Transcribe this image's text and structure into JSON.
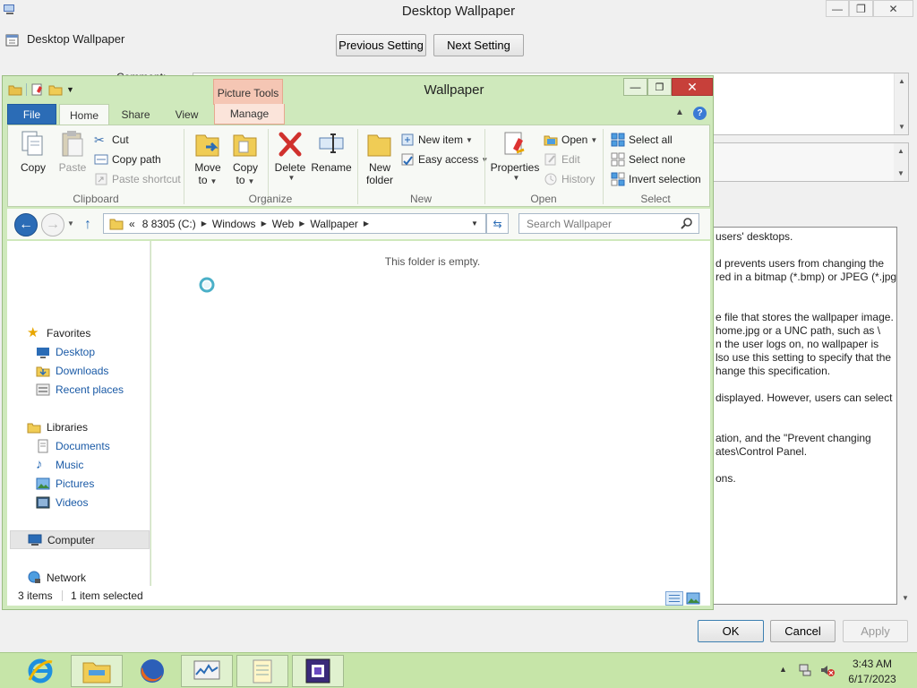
{
  "gp_window": {
    "title": "Desktop Wallpaper",
    "header_label": "Desktop Wallpaper",
    "prev_button": "Previous Setting",
    "next_button": "Next Setting",
    "comment_label": "Comment:",
    "help_lines": [
      "users' desktops.",
      "",
      "d prevents users from changing the",
      "red in a bitmap (*.bmp) or JPEG (*.jpg)",
      "",
      "",
      "e file that stores the wallpaper image.",
      "home.jpg or a UNC path, such as \\",
      "n the user logs on, no wallpaper is",
      "lso use this setting to specify that the",
      "hange this specification.",
      "",
      "displayed. However, users can select",
      "",
      "",
      "ation, and the \"Prevent changing",
      "ates\\Control Panel.",
      "",
      "ons."
    ],
    "ok_button": "OK",
    "cancel_button": "Cancel",
    "apply_button": "Apply"
  },
  "explorer": {
    "title": "Wallpaper",
    "contextual_tab_group": "Picture Tools",
    "tabs": {
      "file": "File",
      "home": "Home",
      "share": "Share",
      "view": "View",
      "manage": "Manage"
    },
    "ribbon": {
      "clipboard": {
        "label": "Clipboard",
        "copy": "Copy",
        "paste": "Paste",
        "cut": "Cut",
        "copy_path": "Copy path",
        "paste_shortcut": "Paste shortcut"
      },
      "organize": {
        "label": "Organize",
        "move_to": "Move",
        "move_to_2": "to",
        "copy_to": "Copy",
        "copy_to_2": "to",
        "delete": "Delete",
        "rename": "Rename"
      },
      "new": {
        "label": "New",
        "new_folder": "New",
        "new_folder_2": "folder",
        "new_item": "New item",
        "easy_access": "Easy access"
      },
      "open": {
        "label": "Open",
        "properties": "Properties",
        "open": "Open",
        "edit": "Edit",
        "history": "History"
      },
      "select": {
        "label": "Select",
        "select_all": "Select all",
        "select_none": "Select none",
        "invert_selection": "Invert selection"
      }
    },
    "address": {
      "overflow": "«",
      "crumbs": [
        "8 8305 (C:)",
        "Windows",
        "Web",
        "Wallpaper"
      ]
    },
    "search_placeholder": "Search Wallpaper",
    "nav": {
      "favorites": "Favorites",
      "desktop": "Desktop",
      "downloads": "Downloads",
      "recent_places": "Recent places",
      "libraries": "Libraries",
      "documents": "Documents",
      "music": "Music",
      "pictures": "Pictures",
      "videos": "Videos",
      "computer": "Computer",
      "network": "Network"
    },
    "empty_message": "This folder is empty.",
    "status": {
      "count": "3 items",
      "selected": "1 item selected"
    }
  },
  "taskbar": {
    "apps": [
      "internet-explorer",
      "file-explorer",
      "firefox",
      "resource-monitor",
      "notepad",
      "app-icon"
    ],
    "clock_time": "3:43 AM",
    "clock_date": "6/17/2023"
  },
  "colors": {
    "accent_blue": "#2b6cb6",
    "window_frame": "#cfe9bc",
    "taskbar": "#c6e5a8",
    "close_red": "#c7403a",
    "picture_tools": "#f5c6b4"
  }
}
